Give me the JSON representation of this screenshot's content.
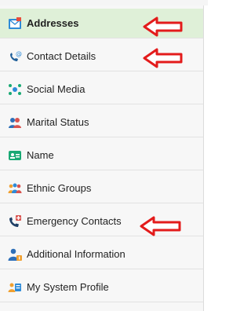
{
  "sidebar": {
    "items": [
      {
        "label": "Addresses",
        "icon": "envelope-icon",
        "active": true
      },
      {
        "label": "Contact Details",
        "icon": "phone-at-icon"
      },
      {
        "label": "Social Media",
        "icon": "social-network-icon"
      },
      {
        "label": "Marital Status",
        "icon": "couple-icon"
      },
      {
        "label": "Name",
        "icon": "name-card-icon"
      },
      {
        "label": "Ethnic Groups",
        "icon": "group-people-icon"
      },
      {
        "label": "Emergency Contacts",
        "icon": "emergency-phone-icon"
      },
      {
        "label": "Additional Information",
        "icon": "user-info-icon"
      },
      {
        "label": "My System Profile",
        "icon": "profile-icon"
      }
    ]
  },
  "colors": {
    "active_bg": "#dff0d8",
    "arrow": "#e31b1b",
    "text": "#222222"
  }
}
